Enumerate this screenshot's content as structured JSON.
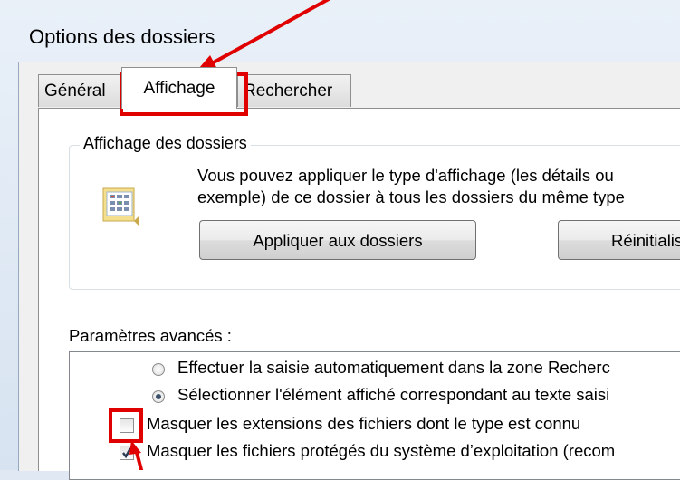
{
  "window": {
    "title": "Options des dossiers"
  },
  "tabs": [
    {
      "label": "Général"
    },
    {
      "label": "Affichage"
    },
    {
      "label": "Rechercher"
    }
  ],
  "folder_views": {
    "group_label": "Affichage des dossiers",
    "description_line1": "Vous pouvez appliquer le type d'affichage (les détails ou",
    "description_line2": "exemple) de ce dossier à tous les dossiers du même type",
    "apply_button": "Appliquer aux dossiers",
    "reset_button": "Réinitialise"
  },
  "advanced": {
    "label": "Paramètres avancés :",
    "items": [
      {
        "type": "radio",
        "checked": false,
        "label": "Effectuer la saisie automatiquement dans la zone Recherc"
      },
      {
        "type": "radio",
        "checked": true,
        "label": "Sélectionner l'élément affiché correspondant au texte saisi"
      },
      {
        "type": "checkbox",
        "checked": false,
        "label": "Masquer les extensions des fichiers dont le type est connu"
      },
      {
        "type": "checkbox",
        "checked": true,
        "label": "Masquer les fichiers protégés du système d’exploitation (recom"
      }
    ]
  },
  "annotation": {
    "highlight_color": "#e00000"
  }
}
